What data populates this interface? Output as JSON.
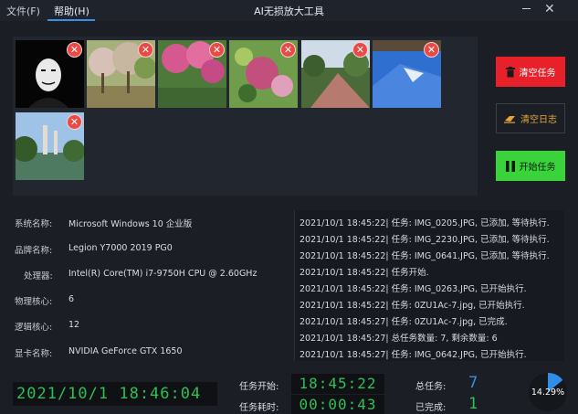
{
  "menu": {
    "file": "文件(F)",
    "help": "帮助(H)"
  },
  "app_title": "AI无损放大工具",
  "images": [
    {
      "id": "img-1"
    },
    {
      "id": "img-2"
    },
    {
      "id": "img-3"
    },
    {
      "id": "img-4"
    },
    {
      "id": "img-5"
    },
    {
      "id": "img-6"
    },
    {
      "id": "img-7"
    }
  ],
  "buttons": {
    "clear_tasks": "清空任务",
    "clear_log": "清空日志",
    "start_tasks": "开始任务"
  },
  "system_info": [
    {
      "label": "系统名称:",
      "value": "Microsoft Windows 10 企业版"
    },
    {
      "label": "品牌名称:",
      "value": "Legion Y7000 2019 PG0"
    },
    {
      "label": "处理器:",
      "value": "Intel(R) Core(TM) i7-9750H CPU @ 2.60GHz"
    },
    {
      "label": "物理核心:",
      "value": "6"
    },
    {
      "label": "逻辑核心:",
      "value": "12"
    },
    {
      "label": "显卡名称:",
      "value": "NVIDIA GeForce GTX 1650"
    }
  ],
  "log": [
    "2021/10/1 18:45:22| 任务: IMG_0205.JPG, 已添加, 等待执行.",
    "2021/10/1 18:45:22| 任务: IMG_2230.JPG, 已添加, 等待执行.",
    "2021/10/1 18:45:22| 任务: IMG_0641.JPG, 已添加, 等待执行.",
    "2021/10/1 18:45:22| 任务开始.",
    "2021/10/1 18:45:22| 任务: IMG_0263.JPG, 已开始执行.",
    "2021/10/1 18:45:22| 任务: 0ZU1Ac-7.jpg, 已开始执行.",
    "2021/10/1 18:45:27| 任务: 0ZU1Ac-7.jpg, 已完成.",
    "2021/10/1 18:45:27| 总任务数量: 7, 剩余数量: 6",
    "2021/10/1 18:45:27| 任务: IMG_0642.JPG, 已开始执行."
  ],
  "clock": "2021/10/1 18:46:04",
  "task_start": {
    "label": "任务开始:",
    "value": "18:45:22"
  },
  "task_elapsed": {
    "label": "任务耗时:",
    "value": "00:00:43"
  },
  "task_total": {
    "label": "总任务:",
    "value": "7"
  },
  "task_done": {
    "label": "已完成:",
    "value": "1"
  },
  "progress": {
    "text": "14.29%",
    "fraction": 0.1429
  },
  "colors": {
    "accent_blue": "#3a8fe0",
    "danger_red": "#e8202a",
    "success_green": "#3bd33b",
    "digit_green": "#2fbf54",
    "warn_orange": "#e9a33a"
  }
}
